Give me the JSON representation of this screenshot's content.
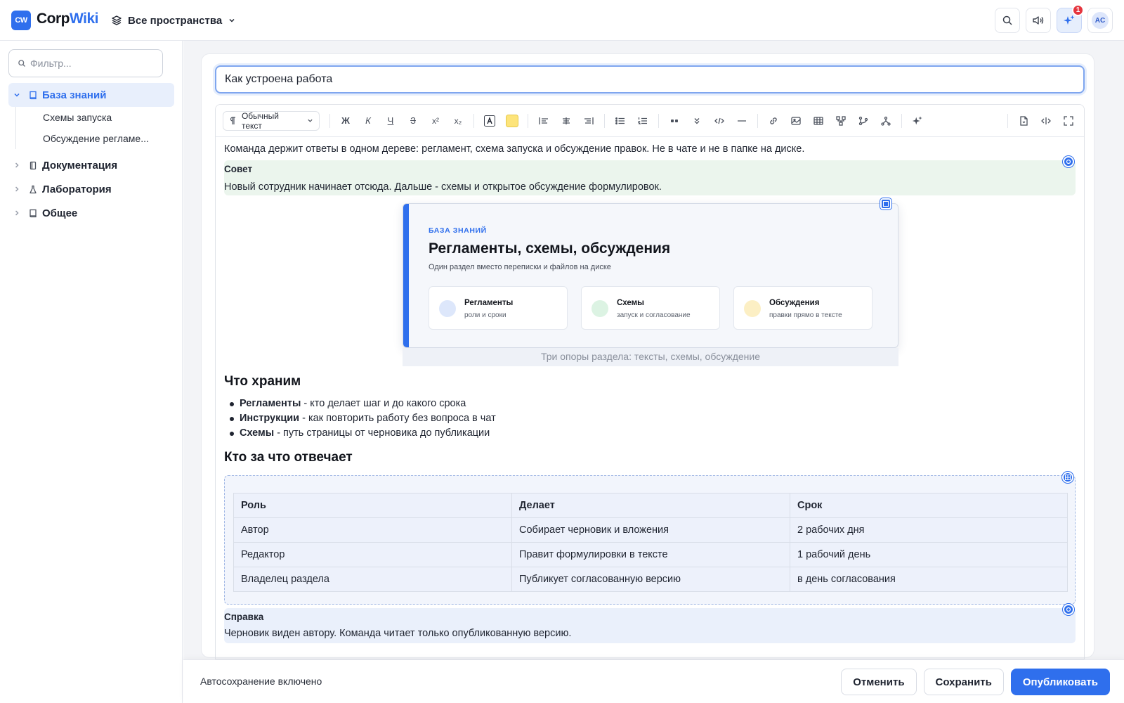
{
  "app": {
    "logo_badge": "CW",
    "logo_part1": "Corp",
    "logo_part2": "Wiki",
    "space_switcher": "Все пространства",
    "notification_count": "1",
    "avatar_initials": "AC",
    "accent_color": "#2f6fed"
  },
  "sidebar": {
    "filter_placeholder": "Фильтр...",
    "items": [
      {
        "label": "База знаний",
        "icon": "book-icon",
        "expanded": true,
        "active": true,
        "children": [
          "Схемы запуска",
          "Обсуждение регламе..."
        ]
      },
      {
        "label": "Документация",
        "icon": "document-icon"
      },
      {
        "label": "Лаборатория",
        "icon": "flask-icon"
      },
      {
        "label": "Общее",
        "icon": "book-icon"
      }
    ]
  },
  "editor": {
    "page_title": "Как устроена работа",
    "style_select": "Обычный текст",
    "toolbar_text_buttons": [
      "Ж",
      "К",
      "Ч",
      "З",
      "x²",
      "x₂"
    ],
    "intro": "Команда держит ответы в одном дереве: регламент, схема запуска и обсуждение правок. Не в чате и не в папке на диске.",
    "tip": {
      "title": "Совет",
      "body": "Новый сотрудник начинает отсюда. Дальше - схемы и открытое обсуждение формулировок.",
      "color": "#ebf5ed"
    },
    "banner": {
      "eyebrow": "БАЗА ЗНАНИЙ",
      "title": "Регламенты, схемы, обсуждения",
      "subtitle": "Один раздел вместо переписки и файлов на диске",
      "cards": [
        {
          "title": "Регламенты",
          "subtitle": "роли и сроки",
          "color": "#dde7fb"
        },
        {
          "title": "Схемы",
          "subtitle": "запуск и согласование",
          "color": "#dcf3e3"
        },
        {
          "title": "Обсуждения",
          "subtitle": "правки прямо в тексте",
          "color": "#fcefc4"
        }
      ],
      "caption": "Три опоры раздела: тексты, схемы, обсуждение"
    },
    "section1": {
      "heading": "Что храним",
      "bullets": [
        {
          "term": "Регламенты",
          "text": " - кто делает шаг и до какого срока"
        },
        {
          "term": "Инструкции",
          "text": " - как повторить работу без вопроса в чат"
        },
        {
          "term": "Схемы",
          "text": " - путь страницы от черновика до публикации"
        }
      ]
    },
    "section2": {
      "heading": "Кто за что отвечает",
      "table": {
        "headers": [
          "Роль",
          "Делает",
          "Срок"
        ],
        "rows": [
          [
            "Автор",
            "Собирает черновик и вложения",
            "2 рабочих дня"
          ],
          [
            "Редактор",
            "Правит формулировки в тексте",
            "1 рабочий день"
          ],
          [
            "Владелец раздела",
            "Публикует согласованную версию",
            "в день согласования"
          ]
        ]
      }
    },
    "note": {
      "title": "Справка",
      "body": "Черновик виден автору. Команда читает только опубликованную версию.",
      "color": "#eaf0fb"
    }
  },
  "footer": {
    "autosave": "Автосохранение включено",
    "cancel": "Отменить",
    "save": "Сохранить",
    "publish": "Опубликовать"
  }
}
